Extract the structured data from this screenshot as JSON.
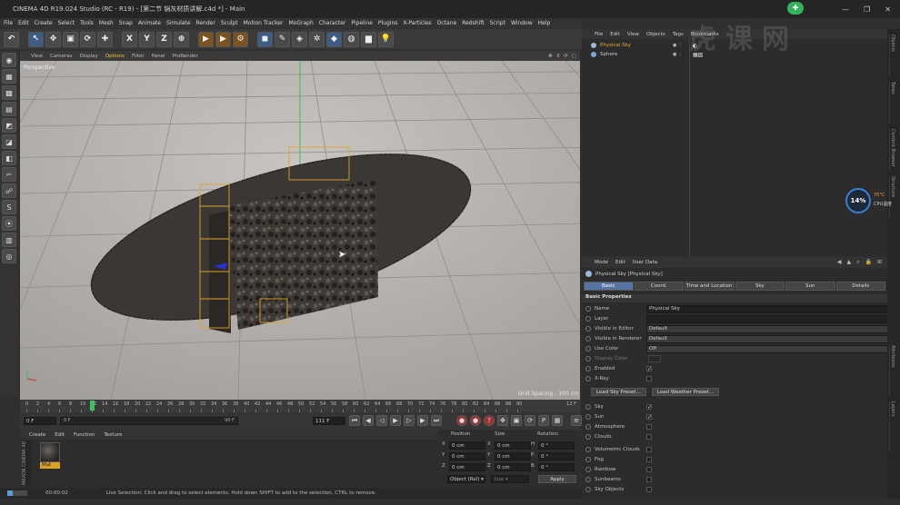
{
  "window": {
    "title": "CINEMA 4D R19.024 Studio (RC - R19) - [第二节 锅灰材质讲解.c4d *] - Main"
  },
  "menubar": {
    "items": [
      "File",
      "Edit",
      "Create",
      "Select",
      "Tools",
      "Mesh",
      "Snap",
      "Animate",
      "Simulate",
      "Render",
      "Sculpt",
      "Motion Tracker",
      "MoGraph",
      "Character",
      "Pipeline",
      "Plugins",
      "X-Particles",
      "Octane",
      "Redshift",
      "Script",
      "Window",
      "Help"
    ]
  },
  "toolbar": {
    "axis_x": "X",
    "axis_y": "Y",
    "axis_z": "Z"
  },
  "viewport": {
    "menu": [
      "View",
      "Cameras",
      "Display",
      "Options",
      "Filter",
      "Panel",
      "ProRender"
    ],
    "label": "Perspective",
    "grid_spacing": "Grid Spacing : 100 cm"
  },
  "timeline": {
    "ticks": [
      "0",
      "2",
      "4",
      "6",
      "8",
      "10",
      "12",
      "14",
      "16",
      "18",
      "20",
      "22",
      "24",
      "26",
      "28",
      "30",
      "32",
      "34",
      "36",
      "38",
      "40",
      "42",
      "44",
      "46",
      "48",
      "50",
      "52",
      "54",
      "56",
      "58",
      "60",
      "62",
      "64",
      "66",
      "68",
      "70",
      "72",
      "74",
      "76",
      "78",
      "80",
      "82",
      "84",
      "86",
      "88",
      "90"
    ],
    "current": "12",
    "end_label": "12 F"
  },
  "playback": {
    "start": "0 F",
    "slider_start": "0 F",
    "slider_end": "90 F",
    "end": "111 F"
  },
  "material_manager": {
    "menu": [
      "Create",
      "Edit",
      "Function",
      "Texture"
    ],
    "material_name": "Mat",
    "brand": "MAXON CINEMA 4D"
  },
  "coordinates": {
    "headers": [
      "Position",
      "Size",
      "Rotation"
    ],
    "rows": [
      {
        "axis": "X",
        "pos": "0 cm",
        "size_axis": "X",
        "size": "0 cm",
        "rot_axis": "H",
        "rot": "0 °"
      },
      {
        "axis": "Y",
        "pos": "0 cm",
        "size_axis": "Y",
        "size": "0 cm",
        "rot_axis": "P",
        "rot": "0 °"
      },
      {
        "axis": "Z",
        "pos": "0 cm",
        "size_axis": "Z",
        "size": "0 cm",
        "rot_axis": "B",
        "rot": "0 °"
      }
    ],
    "mode_select": "Object (Rel) ▾",
    "size_select": "Size ▾",
    "apply_label": "Apply"
  },
  "status": {
    "time": "00:00:02",
    "message": "Live Selection: Click and drag to select elements. Hold down SHIFT to add to the selection, CTRL to remove."
  },
  "object_manager": {
    "menu": [
      "File",
      "Edit",
      "View",
      "Objects",
      "Tags",
      "Bookmarks"
    ],
    "objects": [
      {
        "name": "Physical Sky",
        "selected": true
      },
      {
        "name": "Sphere",
        "selected": false
      }
    ]
  },
  "attribute_manager": {
    "menu": [
      "Mode",
      "Edit",
      "User Data"
    ],
    "object_title": "Physical Sky [Physical Sky]",
    "tabs": [
      {
        "label": "Basic",
        "active": true
      },
      {
        "label": "Coord.",
        "active": false
      },
      {
        "label": "Time and Location",
        "active": false
      },
      {
        "label": "Sky",
        "active": false
      },
      {
        "label": "Sun",
        "active": false
      },
      {
        "label": "Details",
        "active": false
      }
    ],
    "section": "Basic Properties",
    "fields": [
      {
        "label": "Name",
        "value": "Physical Sky"
      },
      {
        "label": "Layer",
        "value": ""
      },
      {
        "label": "Visible in Editor",
        "value": "Default"
      },
      {
        "label": "Visible in Renderer",
        "value": "Default"
      },
      {
        "label": "Use Color",
        "value": "Off"
      },
      {
        "label": "Display Color",
        "value": ""
      }
    ],
    "checks": [
      {
        "label": "Enabled",
        "checked": true
      },
      {
        "label": "X-Ray",
        "checked": false
      }
    ],
    "buttons": [
      "Load Sky Preset...",
      "Load Weather Preset..."
    ],
    "sky_checks": [
      {
        "label": "Sky",
        "checked": true
      },
      {
        "label": "Sun",
        "checked": true
      },
      {
        "label": "Atmosphere",
        "checked": false
      },
      {
        "label": "Clouds",
        "checked": false
      },
      {
        "label": "Volumetric Clouds",
        "checked": false
      },
      {
        "label": "Fog",
        "checked": false
      },
      {
        "label": "Rainbow",
        "checked": false
      },
      {
        "label": "Sunbeams",
        "checked": false
      },
      {
        "label": "Sky Objects",
        "checked": false
      }
    ]
  },
  "cpu_widget": {
    "percent": "14%",
    "temp": "70°C",
    "label": "CPU温度"
  },
  "watermark": "虎课网",
  "right_strip": [
    "Objects",
    "Takes",
    "Content Browser",
    "Structure",
    "Attributes",
    "Layers"
  ]
}
